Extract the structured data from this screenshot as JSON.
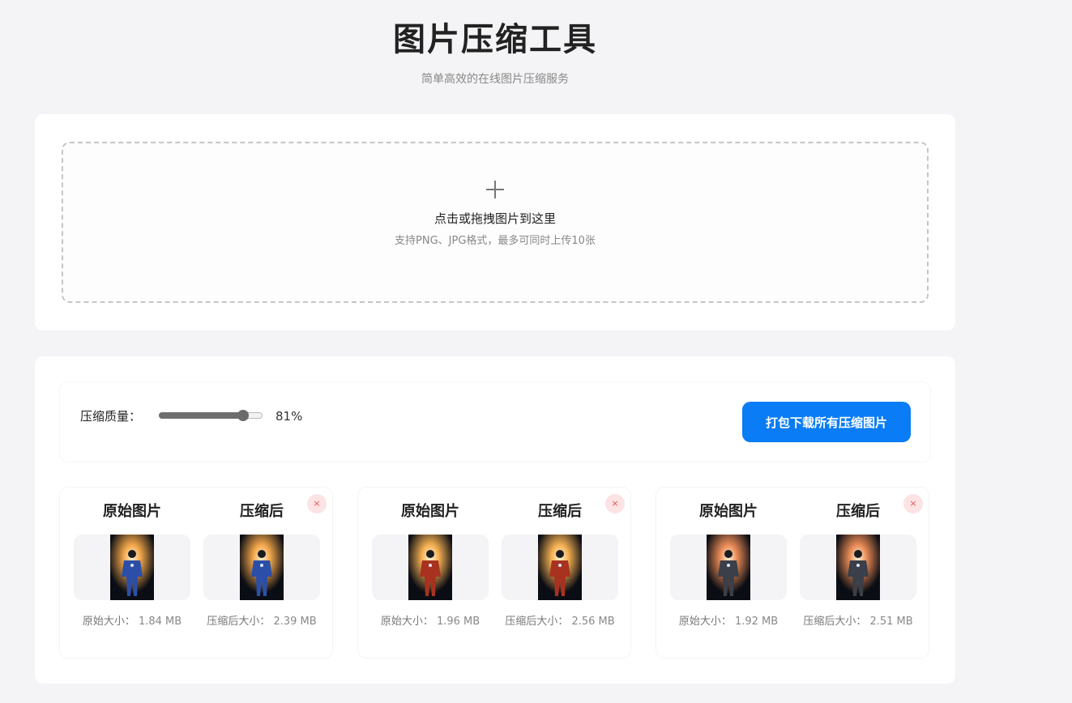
{
  "header": {
    "title": "图片压缩工具",
    "subtitle": "简单高效的在线图片压缩服务"
  },
  "upload": {
    "title": "点击或拖拽图片到这里",
    "hint": "支持PNG、JPG格式，最多可同时上传10张"
  },
  "toolbar": {
    "quality_label": "压缩质量：",
    "quality_value": "81%",
    "quality_fraction": 0.81,
    "download_label": "打包下载所有压缩图片"
  },
  "items": [
    {
      "original_heading": "原始图片",
      "compressed_heading": "压缩后",
      "original_size_label": "原始大小：",
      "original_size": "1.84 MB",
      "compressed_size_label": "压缩后大小：",
      "compressed_size": "2.39 MB",
      "delete_label": "×",
      "accent": "#2b4fa8",
      "glow": "#f2a64a"
    },
    {
      "original_heading": "原始图片",
      "compressed_heading": "压缩后",
      "original_size_label": "原始大小：",
      "original_size": "1.96 MB",
      "compressed_size_label": "压缩后大小：",
      "compressed_size": "2.56 MB",
      "delete_label": "×",
      "accent": "#a8321f",
      "glow": "#f5b052"
    },
    {
      "original_heading": "原始图片",
      "compressed_heading": "压缩后",
      "original_size_label": "原始大小：",
      "original_size": "1.92 MB",
      "compressed_size_label": "压缩后大小：",
      "compressed_size": "2.51 MB",
      "delete_label": "×",
      "accent": "#3a3f4a",
      "glow": "#e98b56"
    }
  ],
  "colors": {
    "primary": "#0a7cf5",
    "background": "#f4f4f6",
    "delete_bg": "#fde3e3"
  }
}
